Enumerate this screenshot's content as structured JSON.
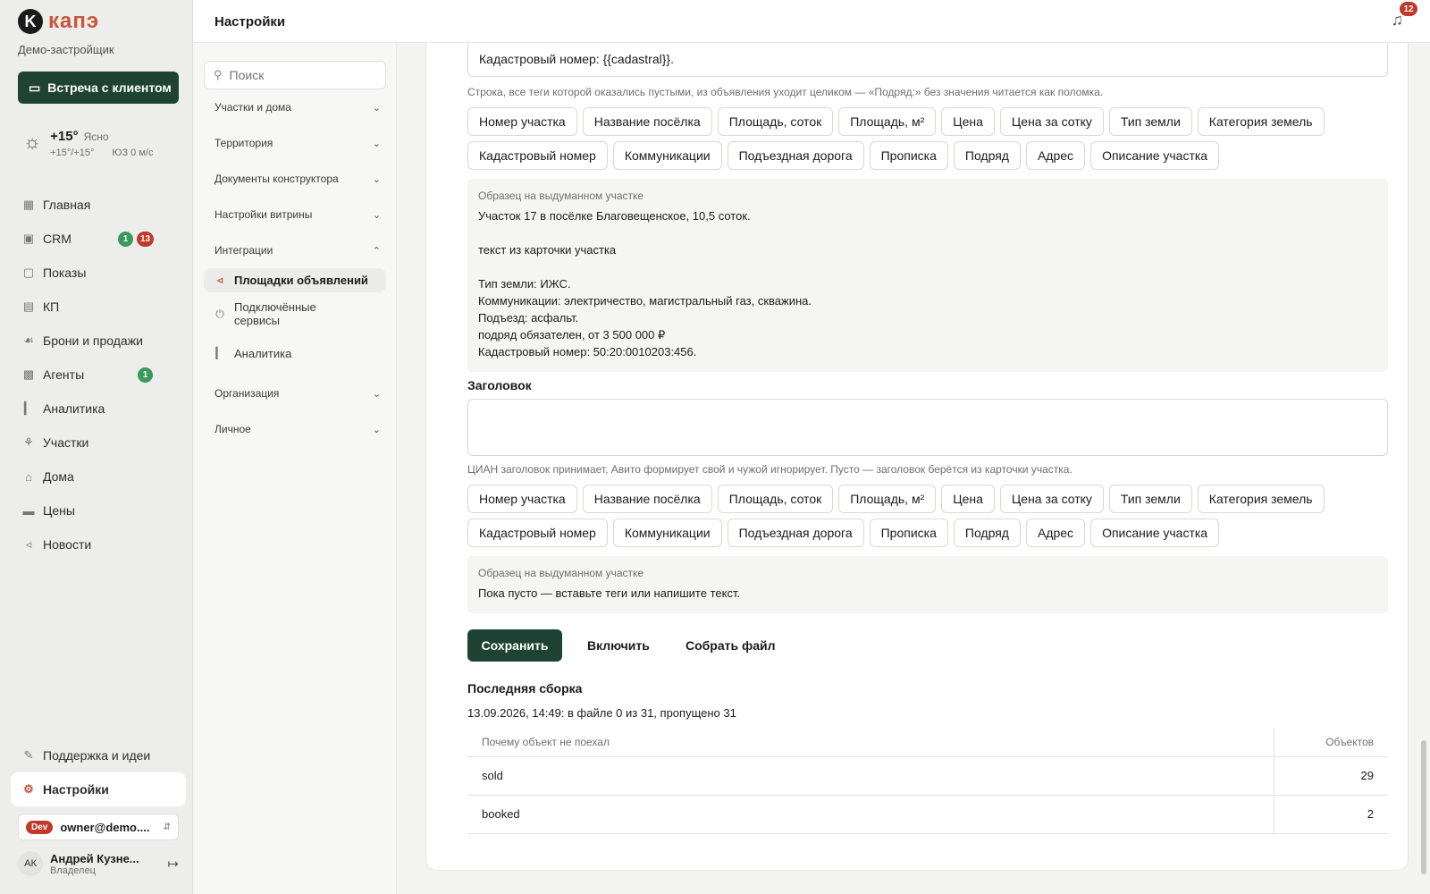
{
  "brand": {
    "mark": "K",
    "name": "капэ",
    "org": "Демо-застройщик"
  },
  "meet_button": "Встреча с клиентом",
  "weather": {
    "temp": "+15°",
    "cond": "Ясно",
    "range": "+15°/+15°",
    "wind": "ЮЗ 0 м/с"
  },
  "nav": {
    "items": [
      {
        "label": "Главная",
        "icon": "grid-icon"
      },
      {
        "label": "CRM",
        "icon": "crm-icon",
        "badges": [
          "1",
          "13"
        ]
      },
      {
        "label": "Показы",
        "icon": "monitor-icon"
      },
      {
        "label": "КП",
        "icon": "document-icon"
      },
      {
        "label": "Брони и продажи",
        "icon": "handshake-icon"
      },
      {
        "label": "Агенты",
        "icon": "building-icon",
        "badges": [
          "1"
        ]
      },
      {
        "label": "Аналитика",
        "icon": "bar-chart-icon"
      },
      {
        "label": "Участки",
        "icon": "sprout-icon"
      },
      {
        "label": "Дома",
        "icon": "house-icon"
      },
      {
        "label": "Цены",
        "icon": "money-icon"
      },
      {
        "label": "Новости",
        "icon": "megaphone-icon"
      }
    ],
    "support": "Поддержка и идеи",
    "settings": "Настройки"
  },
  "dev": {
    "tag": "Dev",
    "email": "owner@demo...."
  },
  "user": {
    "initials": "АК",
    "name": "Андрей Кузне...",
    "role": "Владелец"
  },
  "header": {
    "title": "Настройки",
    "notifications": "12"
  },
  "settings_menu": {
    "search_placeholder": "Поиск",
    "sections": {
      "plots": "Участки и дома",
      "territory": "Территория",
      "docs": "Документы конструктора",
      "showcase": "Настройки витрины",
      "integrations": "Интеграции",
      "organization": "Организация",
      "personal": "Личное"
    },
    "integrations_items": {
      "ads": "Площадки объявлений",
      "services_1": "Подключённые",
      "services_2": "сервисы",
      "analytics": "Аналитика"
    }
  },
  "description": {
    "value": "Кадастровый номер: {{cadastral}}.",
    "hint": "Строка, все теги которой оказались пустыми, из объявления уходит целиком — «Подряд:» без значения читается как поломка.",
    "sample_caption": "Образец на выдуманном участке",
    "sample_lines": [
      "Участок 17 в посёлке Благовещенское, 10,5 соток.",
      "",
      "текст из карточки участка",
      "",
      "Тип земли: ИЖС.",
      "Коммуникации: электричество, магистральный газ, скважина.",
      "Подъезд: асфальт.",
      "подряд обязателен, от 3 500 000 ₽",
      "Кадастровый номер: 50:20:0010203:456."
    ]
  },
  "tags": {
    "row1": [
      "Номер участка",
      "Название посёлка",
      "Площадь, соток",
      "Площадь, м²",
      "Цена",
      "Цена за сотку",
      "Тип земли",
      "Категория земель"
    ],
    "row2": [
      "Кадастровый номер",
      "Коммуникации",
      "Подъездная дорога",
      "Прописка",
      "Подряд",
      "Адрес",
      "Описание участка"
    ]
  },
  "title_field": {
    "label": "Заголовок",
    "value": "",
    "hint": "ЦИАН заголовок принимает, Авито формирует свой и чужой игнорирует. Пусто — заголовок берётся из карточки участка.",
    "sample_caption": "Образец на выдуманном участке",
    "sample_text": "Пока пусто — вставьте теги или напишите текст."
  },
  "actions": {
    "save": "Сохранить",
    "enable": "Включить",
    "build": "Собрать файл"
  },
  "last_build": {
    "title": "Последняя сборка",
    "info": "13.09.2026, 14:49: в файле 0 из 31, пропущено 31",
    "columns": [
      "Почему объект не поехал",
      "Объектов"
    ],
    "rows": [
      {
        "reason": "sold",
        "count": "29"
      },
      {
        "reason": "booked",
        "count": "2"
      }
    ]
  }
}
